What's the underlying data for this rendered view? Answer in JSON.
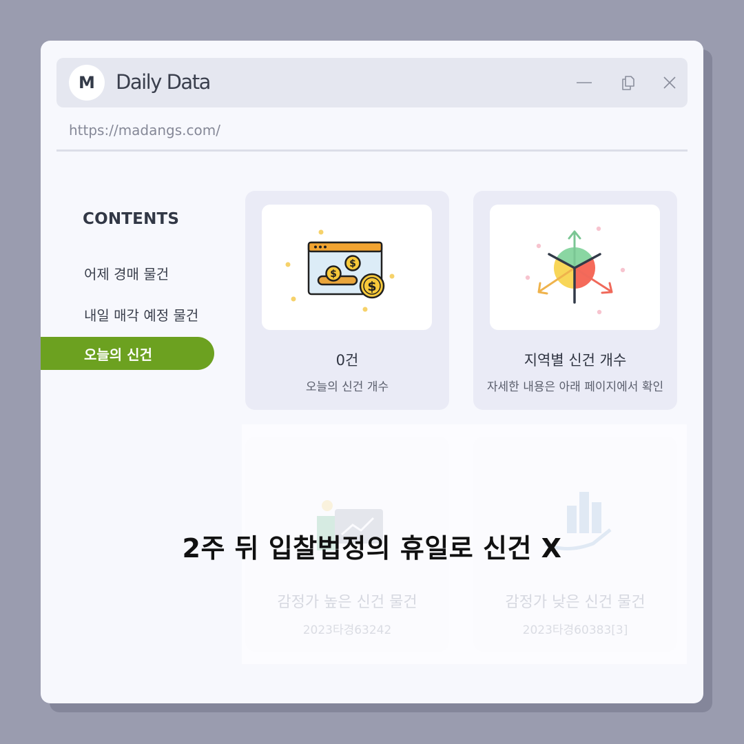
{
  "app": {
    "logo_letter": "M",
    "title": "Daily Data",
    "url": "https://madangs.com/"
  },
  "window_controls": {
    "minimize": "minimize-icon",
    "restore": "restore-icon",
    "close": "close-icon"
  },
  "sidebar": {
    "title": "CONTENTS",
    "items": [
      {
        "label": "어제 경매 물건",
        "active": false
      },
      {
        "label": "내일 매각 예정 물건",
        "active": false
      },
      {
        "label": "오늘의 신건",
        "active": true
      }
    ],
    "active_color": "#6ca120"
  },
  "cards": [
    {
      "icon": "browser-coins-icon",
      "title": "0건",
      "subtitle": "오늘의 신건 개수"
    },
    {
      "icon": "region-arrows-icon",
      "title": "지역별 신건 개수",
      "subtitle": "자세한 내용은 아래 페이지에서 확인"
    }
  ],
  "faded_cards": [
    {
      "icon": "chart-rising-icon",
      "title": "감정가 높은 신건 물건",
      "subtitle": "2023타경63242"
    },
    {
      "icon": "hand-chart-icon",
      "title": "감정가 낮은 신건 물건",
      "subtitle": "2023타경60383[3]"
    }
  ],
  "overlay_text": "2주 뒤 입찰법정의 휴일로 신건 X"
}
